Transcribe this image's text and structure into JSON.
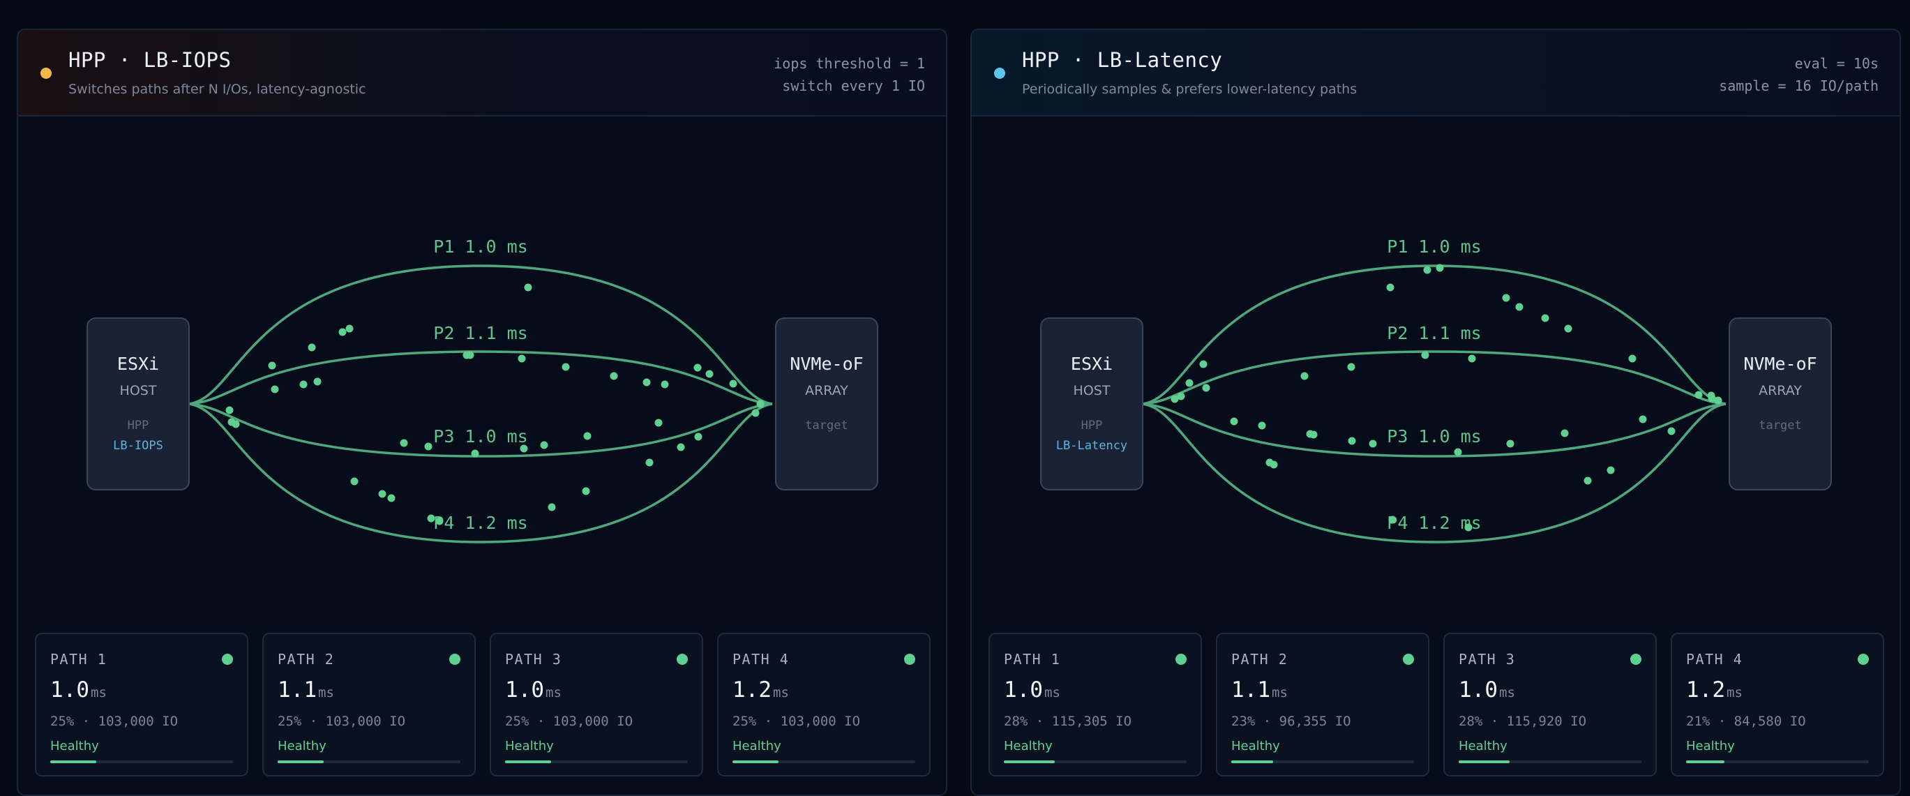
{
  "colors": {
    "accent_green": "#5fd08f",
    "iops_dot": "#f2b84b",
    "latency_dot": "#5cc6f0",
    "policy_blue": "#5fb3e6"
  },
  "panels": [
    {
      "dot_color": "#f2b84b",
      "title": "HPP · LB-IOPS",
      "subtitle": "Switches paths after N I/Os, latency-agnostic",
      "params": [
        "iops threshold = 1",
        "switch every 1 IO"
      ],
      "host": {
        "title": "ESXi",
        "sub": "HOST",
        "small": "HPP",
        "policy": "LB-IOPS"
      },
      "array": {
        "title": "NVMe-oF",
        "sub": "ARRAY",
        "small": "target"
      },
      "path_labels": [
        "P1 1.0 ms",
        "P2 1.1 ms",
        "P3 1.0 ms",
        "P4 1.2 ms"
      ],
      "cards": [
        {
          "name": "PATH 1",
          "value": "1.0",
          "unit": "ms",
          "stats": "25% · 103,000 IO",
          "status": "Healthy",
          "share": 0.25
        },
        {
          "name": "PATH 2",
          "value": "1.1",
          "unit": "ms",
          "stats": "25% · 103,000 IO",
          "status": "Healthy",
          "share": 0.25
        },
        {
          "name": "PATH 3",
          "value": "1.0",
          "unit": "ms",
          "stats": "25% · 103,000 IO",
          "status": "Healthy",
          "share": 0.25
        },
        {
          "name": "PATH 4",
          "value": "1.2",
          "unit": "ms",
          "stats": "25% · 103,000 IO",
          "status": "Healthy",
          "share": 0.25
        }
      ]
    },
    {
      "dot_color": "#5cc6f0",
      "title": "HPP · LB-Latency",
      "subtitle": "Periodically samples & prefers lower-latency paths",
      "params": [
        "eval = 10s",
        "sample = 16 IO/path"
      ],
      "host": {
        "title": "ESXi",
        "sub": "HOST",
        "small": "HPP",
        "policy": "LB-Latency"
      },
      "array": {
        "title": "NVMe-oF",
        "sub": "ARRAY",
        "small": "target"
      },
      "path_labels": [
        "P1 1.0 ms",
        "P2 1.1 ms",
        "P3 1.0 ms",
        "P4 1.2 ms"
      ],
      "cards": [
        {
          "name": "PATH 1",
          "value": "1.0",
          "unit": "ms",
          "stats": "28% · 115,305 IO",
          "status": "Healthy",
          "share": 0.28
        },
        {
          "name": "PATH 2",
          "value": "1.1",
          "unit": "ms",
          "stats": "23% · 96,355 IO",
          "status": "Healthy",
          "share": 0.23
        },
        {
          "name": "PATH 3",
          "value": "1.0",
          "unit": "ms",
          "stats": "28% · 115,920 IO",
          "status": "Healthy",
          "share": 0.28
        },
        {
          "name": "PATH 4",
          "value": "1.2",
          "unit": "ms",
          "stats": "21% · 84,580 IO",
          "status": "Healthy",
          "share": 0.21
        }
      ]
    }
  ]
}
